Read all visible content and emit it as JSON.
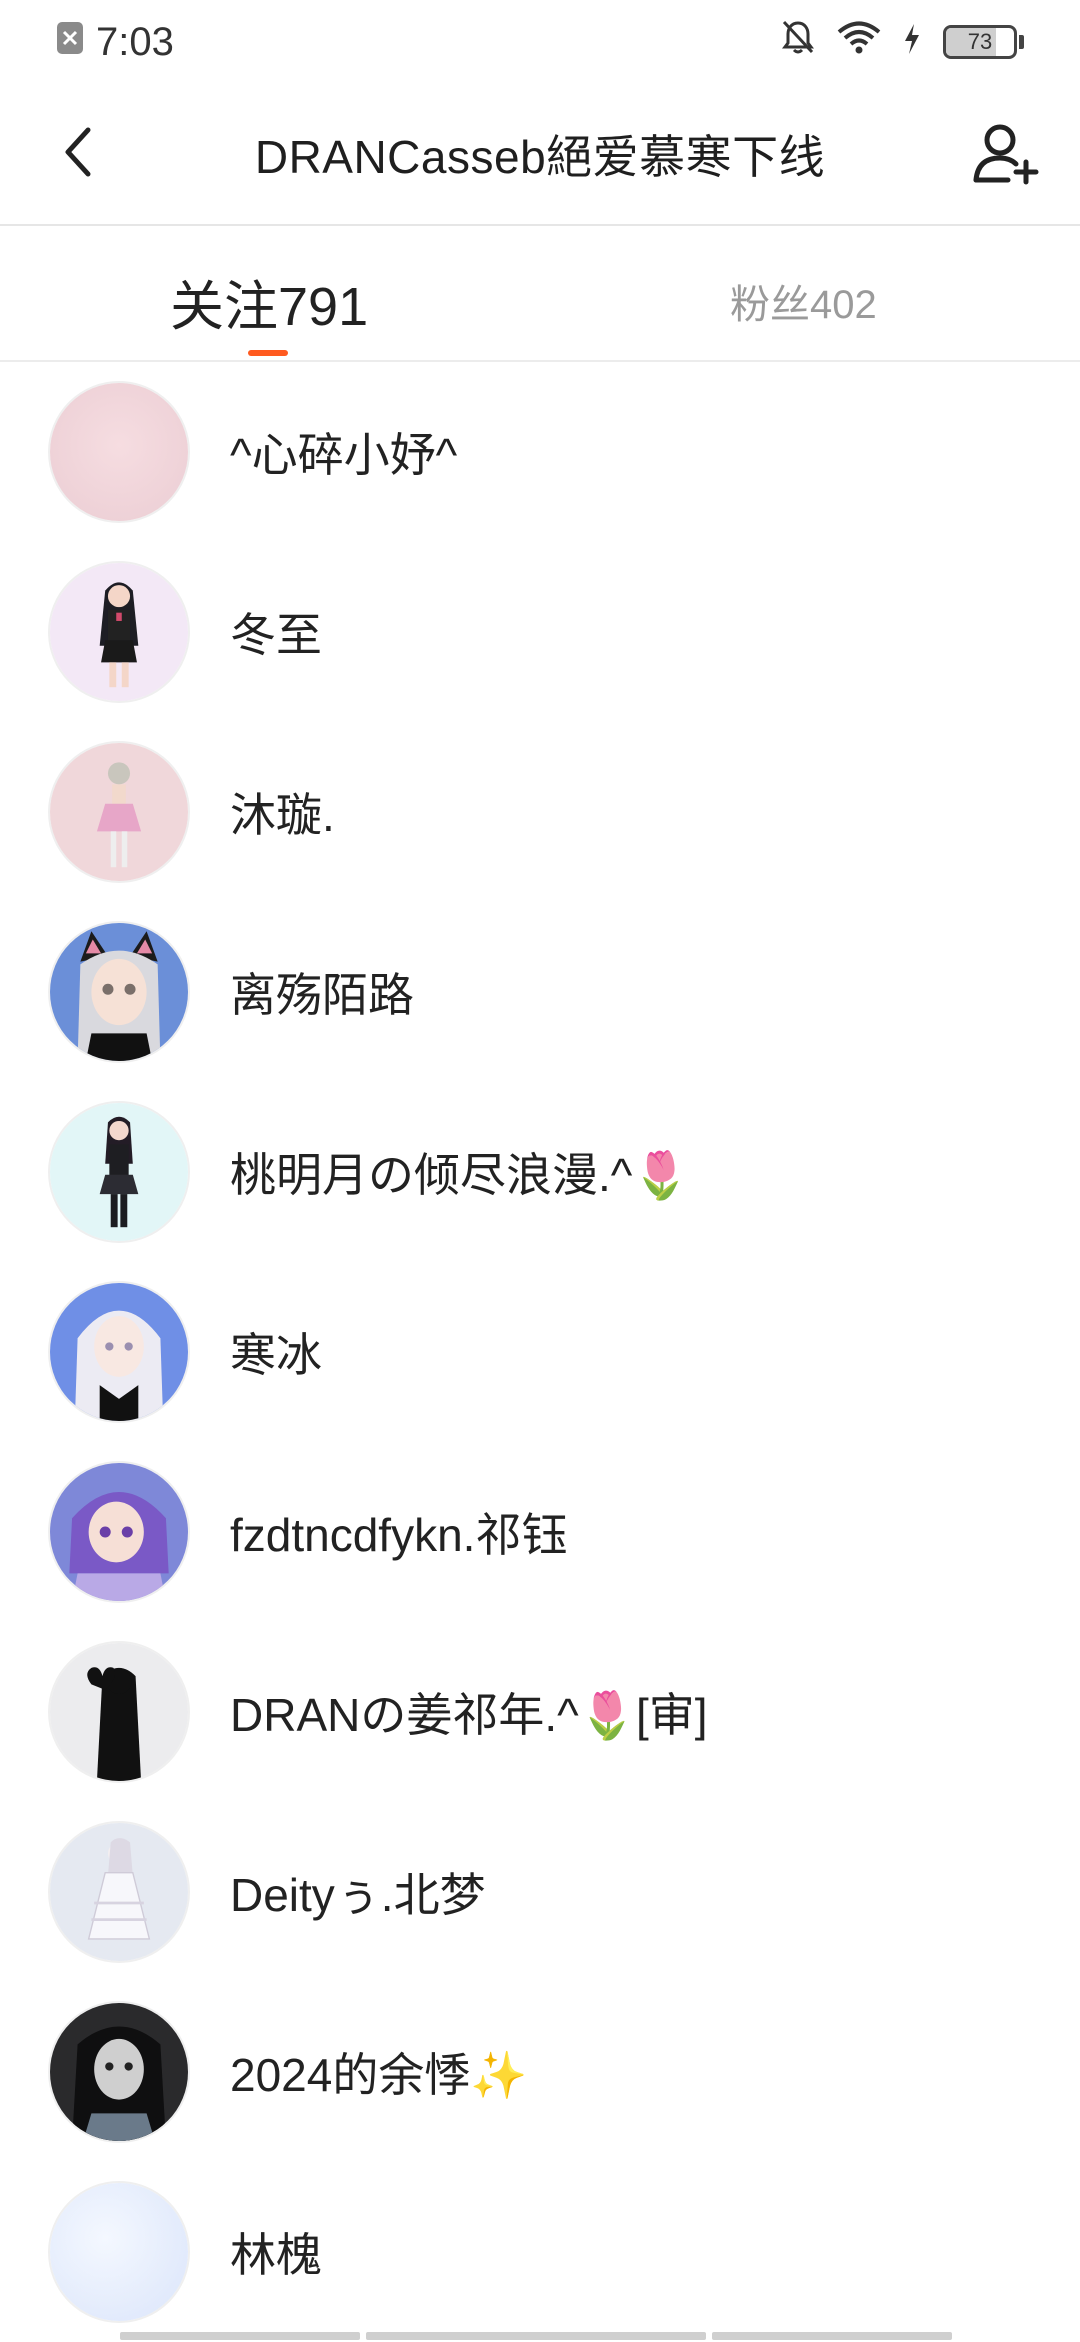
{
  "status_bar": {
    "time": "7:03",
    "battery": 73,
    "battery_text": "73"
  },
  "header": {
    "title": "DRANCasseb絕爱慕寒下线"
  },
  "tabs": {
    "following_label": "关注",
    "following_count": "791",
    "fans_label": "粉丝",
    "fans_count": "402",
    "active": "following"
  },
  "users": [
    {
      "name": "^心碎小妤^",
      "avatar_icon": "avatar-pink-blank"
    },
    {
      "name": "冬至",
      "avatar_icon": "avatar-anime-girl-uniform"
    },
    {
      "name": "沐璇.",
      "avatar_icon": "avatar-anime-girl-pink-dress"
    },
    {
      "name": "离殇陌路",
      "avatar_icon": "avatar-anime-cat-ears"
    },
    {
      "name": "桃明月の倾尽浪漫.^🌷",
      "avatar_icon": "avatar-anime-girl-black-outfit"
    },
    {
      "name": "寒冰",
      "avatar_icon": "avatar-anime-white-hair"
    },
    {
      "name": "fzdtncdfykn.祁钰",
      "avatar_icon": "avatar-anime-purple-hair"
    },
    {
      "name": "DRANの姜祁年.^🌷[审]",
      "avatar_icon": "avatar-silhouette-heart"
    },
    {
      "name": "Deityぅ.北梦",
      "avatar_icon": "avatar-anime-white-dress"
    },
    {
      "name": "2024的余悸✨",
      "avatar_icon": "avatar-photo-dark"
    },
    {
      "name": "林槐",
      "avatar_icon": "avatar-light-blue-blank"
    }
  ],
  "colors": {
    "accent": "#ff5a1f",
    "text_primary": "#222222",
    "text_muted": "#9a9a9a"
  }
}
